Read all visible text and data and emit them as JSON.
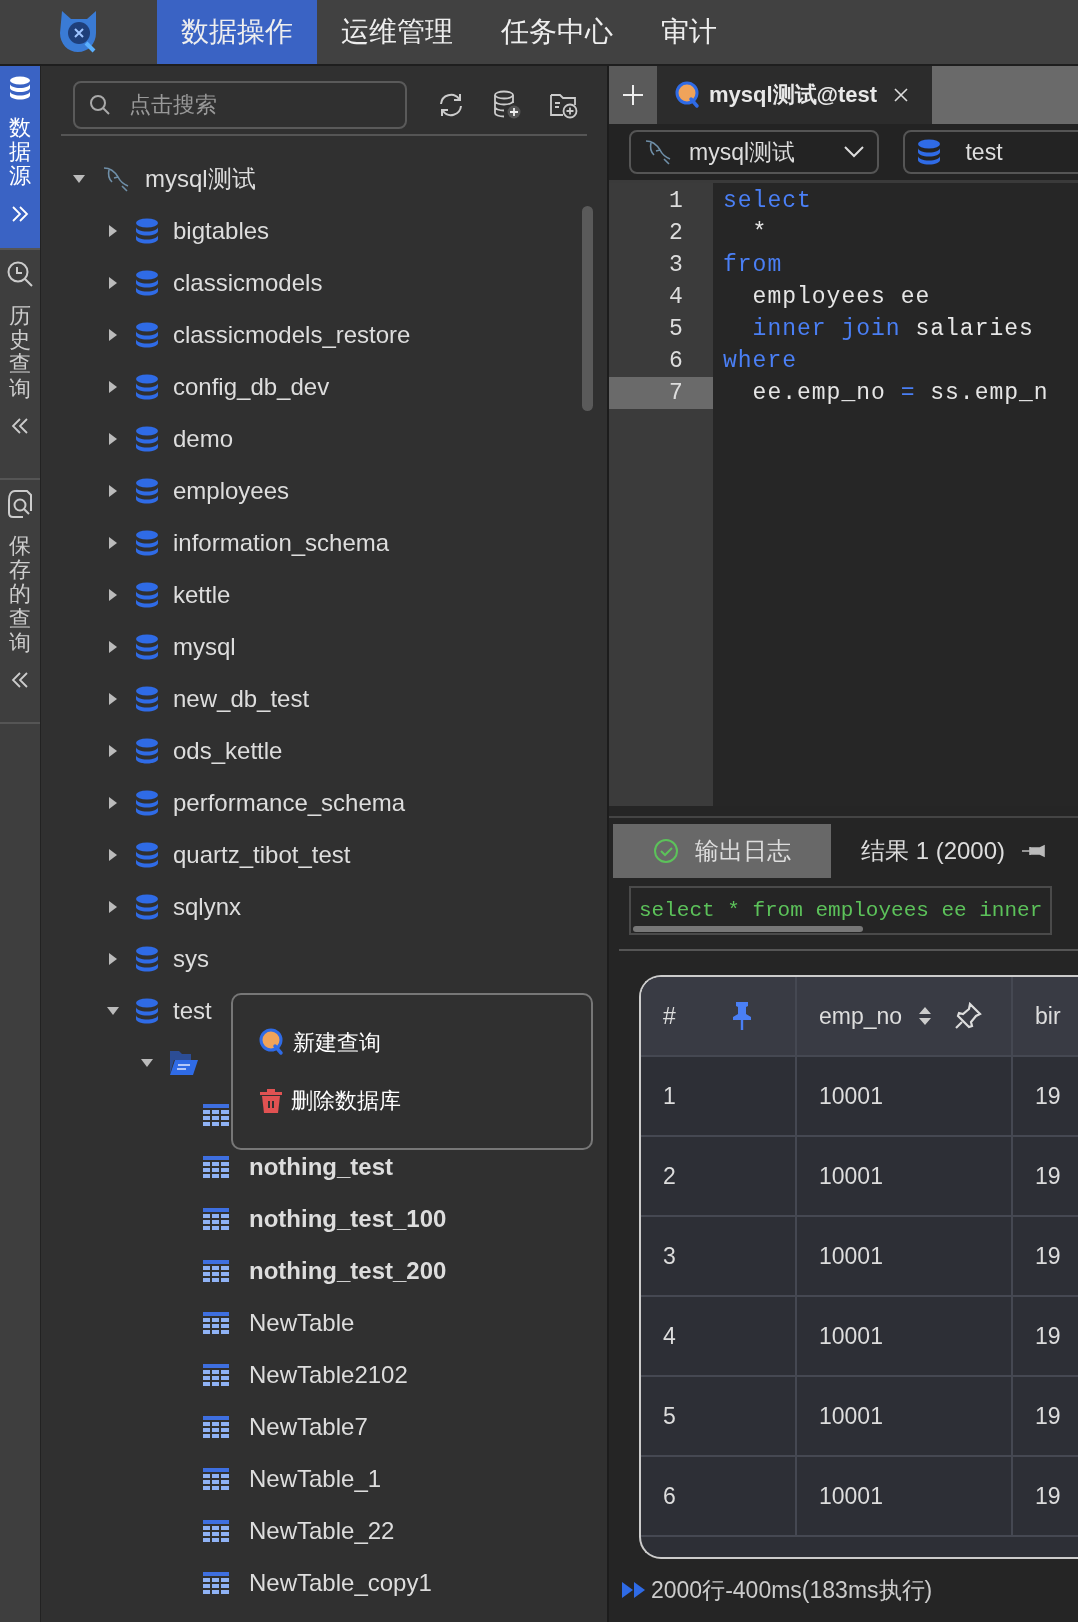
{
  "top_nav": {
    "tabs": [
      {
        "label": "数据操作",
        "selected": true
      },
      {
        "label": "运维管理",
        "selected": false
      },
      {
        "label": "任务中心",
        "selected": false
      },
      {
        "label": "审计",
        "selected": false
      }
    ]
  },
  "side_rail": [
    {
      "kind": "datasource",
      "label": "数据源",
      "selected": true
    },
    {
      "kind": "history",
      "label": "历史查询",
      "selected": false
    },
    {
      "kind": "saved",
      "label": "保存的查询",
      "selected": false
    }
  ],
  "explorer": {
    "search": {
      "placeholder": "点击搜索"
    },
    "tree": [
      {
        "kind": "connection",
        "label": "mysql测试",
        "expanded": true,
        "children": [
          {
            "kind": "database",
            "label": "bigtables",
            "expanded": false
          },
          {
            "kind": "database",
            "label": "classicmodels",
            "expanded": false
          },
          {
            "kind": "database",
            "label": "classicmodels_restore",
            "expanded": false
          },
          {
            "kind": "database",
            "label": "config_db_dev",
            "expanded": false
          },
          {
            "kind": "database",
            "label": "demo",
            "expanded": false
          },
          {
            "kind": "database",
            "label": "employees",
            "expanded": false
          },
          {
            "kind": "database",
            "label": "information_schema",
            "expanded": false
          },
          {
            "kind": "database",
            "label": "kettle",
            "expanded": false
          },
          {
            "kind": "database",
            "label": "mysql",
            "expanded": false
          },
          {
            "kind": "database",
            "label": "new_db_test",
            "expanded": false
          },
          {
            "kind": "database",
            "label": "ods_kettle",
            "expanded": false
          },
          {
            "kind": "database",
            "label": "performance_schema",
            "expanded": false
          },
          {
            "kind": "database",
            "label": "quartz_tibot_test",
            "expanded": false
          },
          {
            "kind": "database",
            "label": "sqlynx",
            "expanded": false
          },
          {
            "kind": "database",
            "label": "sys",
            "expanded": false
          },
          {
            "kind": "database",
            "label": "test",
            "expanded": true,
            "children": [
              {
                "kind": "folder",
                "expanded": true,
                "children": [
                  {
                    "kind": "table"
                  },
                  {
                    "kind": "table",
                    "label": "nothing_test",
                    "bold": true
                  },
                  {
                    "kind": "table",
                    "label": "nothing_test_100",
                    "bold": true
                  },
                  {
                    "kind": "table",
                    "label": "nothing_test_200",
                    "bold": true
                  },
                  {
                    "kind": "table",
                    "label": "NewTable",
                    "bold": false
                  },
                  {
                    "kind": "table",
                    "label": "NewTable2102",
                    "bold": false
                  },
                  {
                    "kind": "table",
                    "label": "NewTable7",
                    "bold": false
                  },
                  {
                    "kind": "table",
                    "label": "NewTable_1",
                    "bold": false
                  },
                  {
                    "kind": "table",
                    "label": "NewTable_22",
                    "bold": false
                  },
                  {
                    "kind": "table",
                    "label": "NewTable_copy1",
                    "bold": false
                  }
                ]
              }
            ]
          }
        ]
      }
    ]
  },
  "context_menu": {
    "items": [
      {
        "kind": "query",
        "label": "新建查询"
      },
      {
        "kind": "delete",
        "label": "删除数据库"
      }
    ]
  },
  "editor": {
    "tabs": [
      {
        "label": "mysql测试@test",
        "selected": true
      }
    ],
    "connection": "mysql测试",
    "database": "test",
    "lines": [
      {
        "number": "1",
        "selected": false,
        "tokens": [
          {
            "kind": "keyword",
            "text": "select"
          }
        ]
      },
      {
        "number": "2",
        "selected": false,
        "tokens": [
          {
            "kind": "text",
            "text": "  *"
          }
        ]
      },
      {
        "number": "3",
        "selected": false,
        "tokens": [
          {
            "kind": "keyword",
            "text": "from"
          }
        ]
      },
      {
        "number": "4",
        "selected": false,
        "tokens": [
          {
            "kind": "text",
            "text": "  employees ee"
          }
        ]
      },
      {
        "number": "5",
        "selected": false,
        "tokens": [
          {
            "kind": "keyword",
            "text": "  inner join"
          },
          {
            "kind": "text",
            "text": " salaries"
          }
        ]
      },
      {
        "number": "6",
        "selected": false,
        "tokens": [
          {
            "kind": "keyword",
            "text": "where"
          }
        ]
      },
      {
        "number": "7",
        "selected": true,
        "tokens": [
          {
            "kind": "text",
            "text": "  ee.emp_no "
          },
          {
            "kind": "keyword",
            "text": "="
          },
          {
            "kind": "text",
            "text": " ss.emp_n"
          }
        ]
      }
    ]
  },
  "results": {
    "tabs": [
      {
        "kind": "log",
        "label": "输出日志",
        "selected": true
      },
      {
        "kind": "result",
        "label": "结果 1 (2000)",
        "selected": false
      }
    ],
    "log": "select * from employees ee inner",
    "table": {
      "columns": [
        {
          "label": "#",
          "pinned": true
        },
        {
          "label": "emp_no",
          "pinned": false,
          "sortable": true
        },
        {
          "label": "bir"
        }
      ],
      "rows": [
        [
          "1",
          "10001",
          "19"
        ],
        [
          "2",
          "10001",
          "19"
        ],
        [
          "3",
          "10001",
          "19"
        ],
        [
          "4",
          "10001",
          "19"
        ],
        [
          "5",
          "10001",
          "19"
        ],
        [
          "6",
          "10001",
          "19"
        ]
      ]
    },
    "status": "2000行-400ms(183ms执行)"
  }
}
